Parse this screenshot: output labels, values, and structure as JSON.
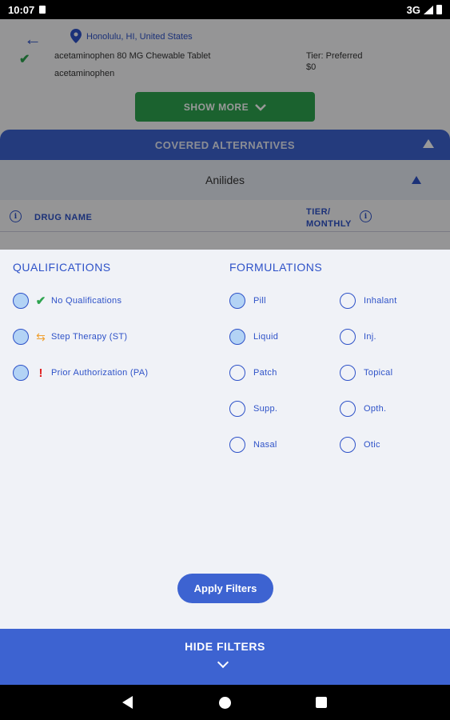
{
  "status_bar": {
    "time": "10:07",
    "network": "3G"
  },
  "header": {
    "location": "Honolulu, HI, United States"
  },
  "drug_row": {
    "name": "acetaminophen 80 MG Chewable Tablet",
    "generic": "acetaminophen",
    "tier": "Tier: Preferred",
    "price": "$0"
  },
  "show_more_label": "SHOW MORE",
  "covered_alternatives_label": "COVERED ALTERNATIVES",
  "group_label": "Anilides",
  "columns": {
    "drug_name": "DRUG NAME",
    "tier_monthly_line1": "TIER/",
    "tier_monthly_line2": "MONTHLY"
  },
  "qualifications": {
    "title": "QUALIFICATIONS",
    "options": [
      {
        "label": "No Qualifications",
        "icon": "check-icon",
        "selected": true
      },
      {
        "label": "Step Therapy (ST)",
        "icon": "swap-arrows-icon",
        "selected": true
      },
      {
        "label": "Prior Authorization (PA)",
        "icon": "exclamation-icon",
        "selected": true
      }
    ]
  },
  "formulations": {
    "title": "FORMULATIONS",
    "options": [
      {
        "label": "Pill",
        "selected": true
      },
      {
        "label": "Inhalant",
        "selected": false
      },
      {
        "label": "Liquid",
        "selected": true
      },
      {
        "label": "Inj.",
        "selected": false
      },
      {
        "label": "Patch",
        "selected": false
      },
      {
        "label": "Topical",
        "selected": false
      },
      {
        "label": "Supp.",
        "selected": false
      },
      {
        "label": "Opth.",
        "selected": false
      },
      {
        "label": "Nasal",
        "selected": false
      },
      {
        "label": "Otic",
        "selected": false
      }
    ]
  },
  "apply_label": "Apply Filters",
  "hide_filters_label": "HIDE FILTERS",
  "colors": {
    "accent": "#3d63d1",
    "green": "#2ea44f",
    "selected_fill": "#b3d3f5"
  }
}
